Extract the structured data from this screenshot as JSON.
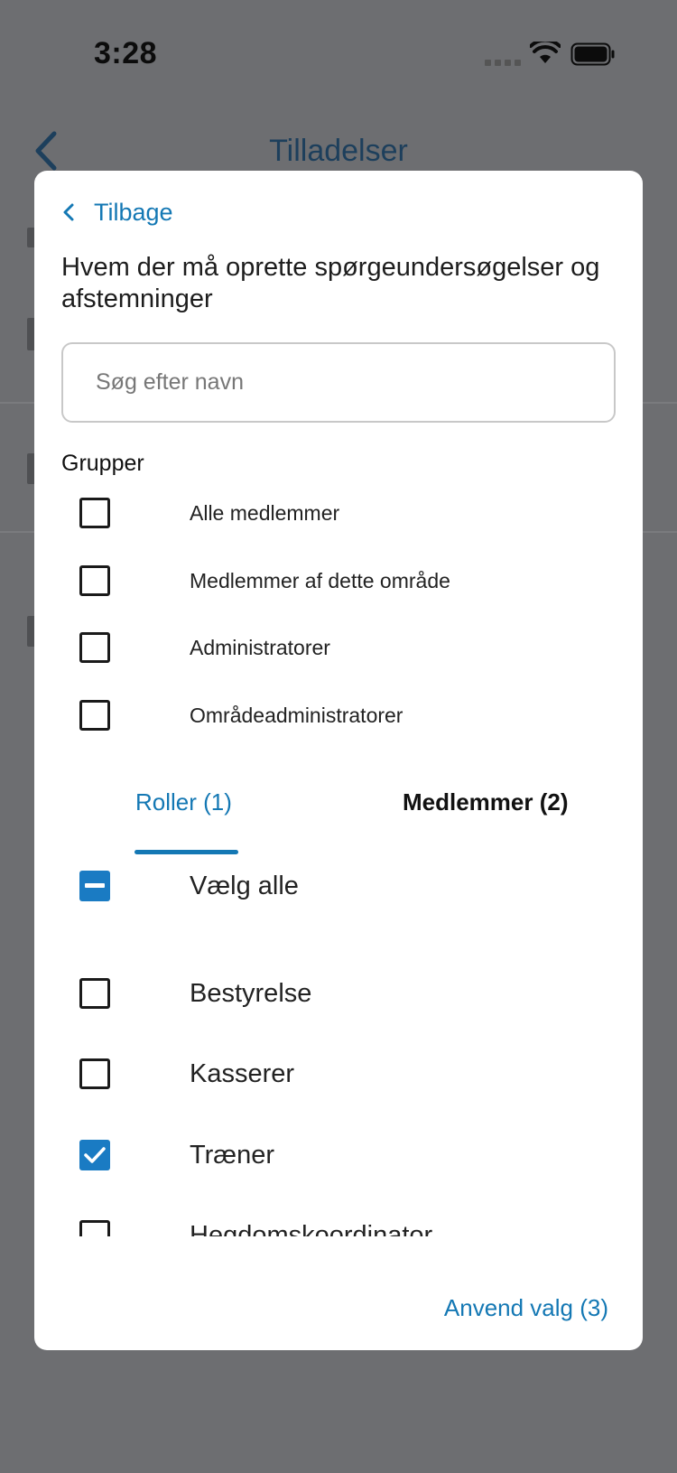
{
  "status_bar": {
    "time": "3:28"
  },
  "background": {
    "title": "Tilladelser"
  },
  "modal": {
    "back_label": "Tilbage",
    "title": "Hvem der må oprette spørgeundersøgelser og afstemninger",
    "search": {
      "placeholder": "Søg efter navn",
      "value": ""
    },
    "groups_label": "Grupper",
    "groups": [
      {
        "label": "Alle medlemmer",
        "checked": false
      },
      {
        "label": "Medlemmer af dette område",
        "checked": false
      },
      {
        "label": "Administratorer",
        "checked": false
      },
      {
        "label": "Områdeadministratorer",
        "checked": false
      }
    ],
    "tabs": [
      {
        "label": "Roller (1)",
        "active": true
      },
      {
        "label": "Medlemmer (2)",
        "active": false
      }
    ],
    "select_all": {
      "label": "Vælg alle",
      "state": "indeterminate"
    },
    "roles": [
      {
        "label": "Bestyrelse",
        "checked": false
      },
      {
        "label": "Kasserer",
        "checked": false
      },
      {
        "label": "Træner",
        "checked": true
      },
      {
        "label": "Hegdomskoordinator",
        "checked": false
      }
    ],
    "apply_label": "Anvend valg (3)"
  },
  "colors": {
    "accent": "#1478b4",
    "checkbox_fill": "#1a7bc3",
    "overlay": "#6d6e71"
  },
  "icons": {
    "status": [
      "cellular-signal-icon",
      "wifi-icon",
      "battery-icon"
    ],
    "navigation": [
      "chevron-left-icon"
    ]
  }
}
